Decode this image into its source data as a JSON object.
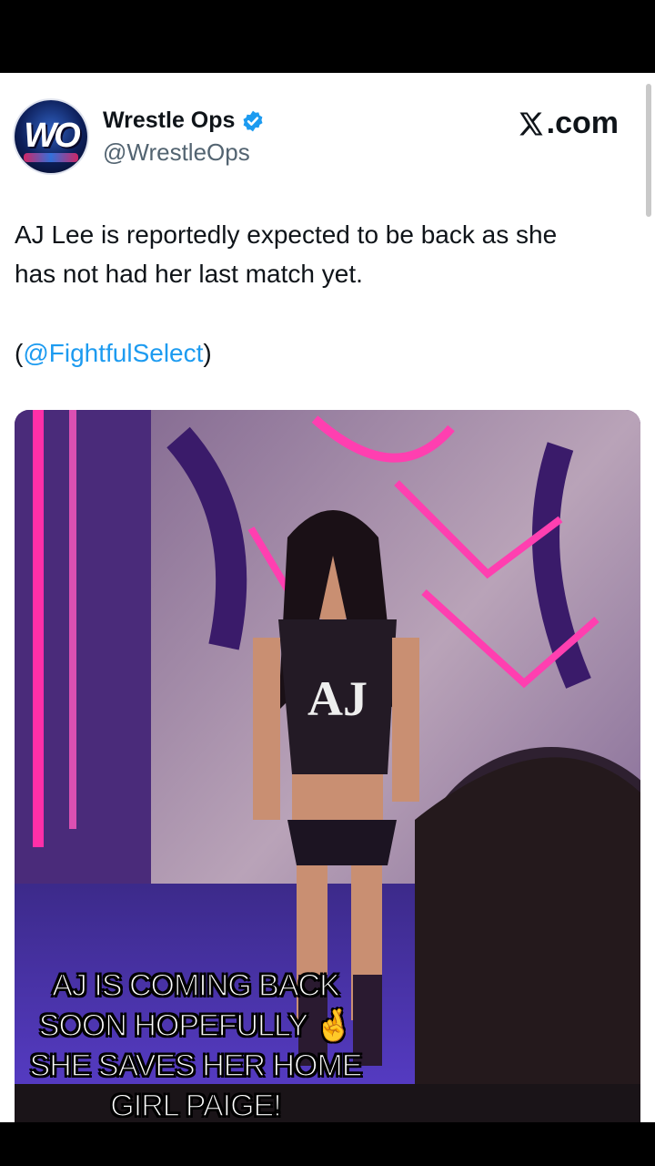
{
  "tweet": {
    "author_name": "Wrestle Ops",
    "author_handle": "@WrestleOps",
    "avatar_text": "WO",
    "site": ".com",
    "text_line1": "AJ Lee is reportedly expected to be back as she",
    "text_line2": "has not had her last match yet.",
    "source_open": "(",
    "source_mention": "@FightfulSelect",
    "source_close": ")"
  },
  "caption": {
    "line1": "AJ IS COMING BACK",
    "line2": "SOON HOPEFULLY 🤞",
    "line3": "SHE SAVES HER HOME",
    "line4": "GIRL PAIGE!"
  },
  "icons": {
    "verified": "verified-badge-icon",
    "x_logo": "x-logo-icon"
  },
  "colors": {
    "accent": "#1d9bf0",
    "text": "#0f1419",
    "secondary": "#536471"
  }
}
